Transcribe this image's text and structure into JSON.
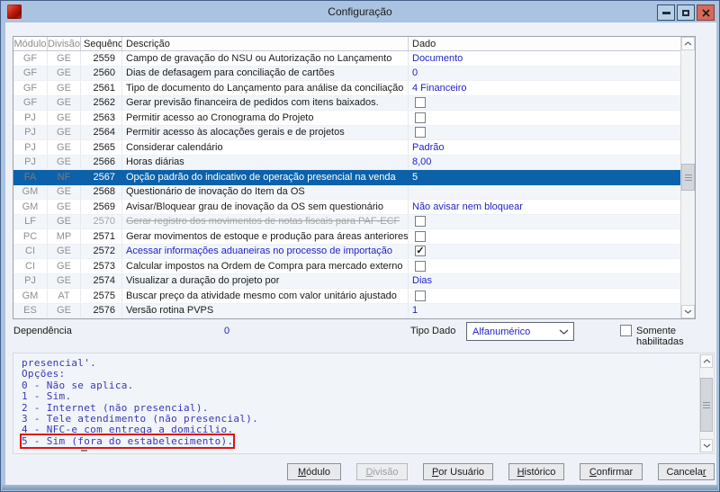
{
  "window": {
    "title": "Configuração"
  },
  "table": {
    "columns": [
      "Módulo",
      "Divisão",
      "Sequência",
      "Descrição",
      "Dado"
    ],
    "rows": [
      {
        "modulo": "GF",
        "divisao": "GE",
        "seq": "2559",
        "desc": "Campo de gravação do NSU ou Autorização no Lançamento",
        "dado": "Documento",
        "dado_type": "text"
      },
      {
        "modulo": "GF",
        "divisao": "GE",
        "seq": "2560",
        "desc": "Dias de defasagem para conciliação de cartões",
        "dado": "0",
        "dado_type": "text"
      },
      {
        "modulo": "GF",
        "divisao": "GE",
        "seq": "2561",
        "desc": "Tipo de documento do Lançamento para análise da conciliação",
        "dado": "4 Financeiro",
        "dado_type": "text"
      },
      {
        "modulo": "GF",
        "divisao": "GE",
        "seq": "2562",
        "desc": "Gerar previsão financeira de pedidos com itens baixados.",
        "dado_type": "checkbox",
        "checked": false
      },
      {
        "modulo": "PJ",
        "divisao": "GE",
        "seq": "2563",
        "desc": "Permitir acesso ao Cronograma do Projeto",
        "dado_type": "checkbox",
        "checked": false
      },
      {
        "modulo": "PJ",
        "divisao": "GE",
        "seq": "2564",
        "desc": "Permitir acesso às alocações gerais e de projetos",
        "dado_type": "checkbox",
        "checked": false
      },
      {
        "modulo": "PJ",
        "divisao": "GE",
        "seq": "2565",
        "desc": "Considerar calendário",
        "dado": "Padrão",
        "dado_type": "text"
      },
      {
        "modulo": "PJ",
        "divisao": "GE",
        "seq": "2566",
        "desc": "Horas diárias",
        "dado": "8,00",
        "dado_type": "text"
      },
      {
        "modulo": "FA",
        "divisao": "NF",
        "seq": "2567",
        "desc": "Opção padrão do indicativo de operação presencial na venda",
        "dado": "5",
        "dado_type": "text",
        "selected": true
      },
      {
        "modulo": "GM",
        "divisao": "GE",
        "seq": "2568",
        "desc": "Questionário de inovação do Item da OS",
        "dado": "",
        "dado_type": "text"
      },
      {
        "modulo": "GM",
        "divisao": "GE",
        "seq": "2569",
        "desc": "Avisar/Bloquear grau de inovação da OS sem questionário",
        "dado": "Não avisar nem bloquear",
        "dado_type": "text"
      },
      {
        "modulo": "LF",
        "divisao": "GE",
        "seq": "2570",
        "desc": "Gerar registro dos movimentos de notas fiscais para PAF-ECF",
        "dado_type": "checkbox",
        "checked": false,
        "strike": true
      },
      {
        "modulo": "PC",
        "divisao": "MP",
        "seq": "2571",
        "desc": "Gerar movimentos de estoque e produção para áreas anteriores",
        "dado_type": "checkbox",
        "checked": false
      },
      {
        "modulo": "CI",
        "divisao": "GE",
        "seq": "2572",
        "desc": "Acessar informações aduaneiras no processo de importação",
        "dado_type": "checkbox",
        "checked": true,
        "desc_blue": true
      },
      {
        "modulo": "CI",
        "divisao": "GE",
        "seq": "2573",
        "desc": "Calcular impostos na Ordem de Compra para mercado externo",
        "dado_type": "checkbox",
        "checked": false
      },
      {
        "modulo": "PJ",
        "divisao": "GE",
        "seq": "2574",
        "desc": "Visualizar a duração do projeto por",
        "dado": "Dias",
        "dado_type": "text"
      },
      {
        "modulo": "GM",
        "divisao": "AT",
        "seq": "2575",
        "desc": "Buscar preço da atividade mesmo com valor unitário ajustado",
        "dado_type": "checkbox",
        "checked": false
      },
      {
        "modulo": "ES",
        "divisao": "GE",
        "seq": "2576",
        "desc": "Versão rotina PVPS",
        "dado": "1",
        "dado_type": "text"
      }
    ]
  },
  "info": {
    "dependencia_label": "Dependência",
    "dependencia_value": "0",
    "tipo_dado_label": "Tipo Dado",
    "tipo_dado_value": "Alfanumérico",
    "somente_habilitadas_label": "Somente habilitadas",
    "somente_habilitadas_checked": false
  },
  "description_box": {
    "lines": [
      "presencial'.",
      "Opções:",
      "0 - Não se aplica.",
      "1 - Sim.",
      "2 - Internet (não presencial).",
      "3 - Tele atendimento (não presencial).",
      "4 - NFC-e com entrega a domicílio.",
      "5 - Sim (fora do estabelecimento)."
    ],
    "highlighted_line_index": 7
  },
  "buttons": [
    {
      "label": "Módulo",
      "underline_index": 0,
      "disabled": false
    },
    {
      "label": "Divisão",
      "underline_index": 0,
      "disabled": true
    },
    {
      "label": "Por Usuário",
      "underline_index": 0,
      "disabled": false
    },
    {
      "label": "Histórico",
      "underline_index": 0,
      "disabled": false
    },
    {
      "label": "Confirmar",
      "underline_index": 0,
      "disabled": false
    },
    {
      "label": "Cancelar",
      "underline_index": 7,
      "disabled": false
    }
  ],
  "colors": {
    "titlebar": "#a9c3e0",
    "selection_blue": "#0b62ab",
    "data_text_blue": "#1f1fc8",
    "mono_text_blue": "#3939b5",
    "annotation_red": "#e01212",
    "close_button_red": "#d5695b"
  }
}
